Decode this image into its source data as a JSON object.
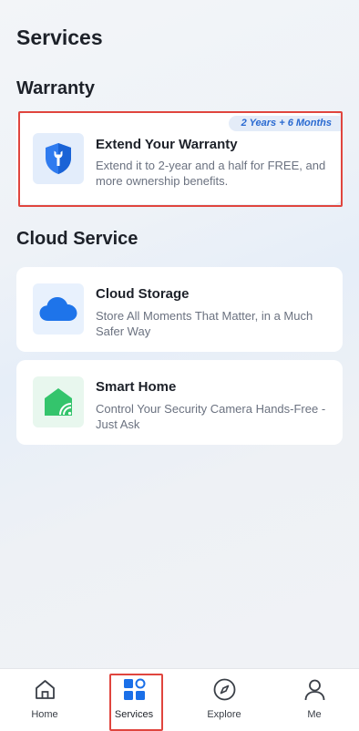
{
  "page": {
    "title": "Services"
  },
  "warranty": {
    "section_title": "Warranty",
    "card": {
      "badge": "2 Years + 6 Months",
      "title": "Extend Your Warranty",
      "description": "Extend it to 2-year and a half for FREE, and more ownership benefits.",
      "icon": "shield-wrench-icon"
    }
  },
  "cloud_service": {
    "section_title": "Cloud Service",
    "items": [
      {
        "title": "Cloud Storage",
        "description": "Store All Moments That Matter, in a Much Safer Way",
        "icon": "cloud-icon"
      },
      {
        "title": "Smart Home",
        "description": "Control Your Security Camera Hands-Free - Just Ask",
        "icon": "smart-home-icon"
      }
    ]
  },
  "tabbar": {
    "tabs": [
      {
        "label": "Home",
        "icon": "home-icon"
      },
      {
        "label": "Services",
        "icon": "services-icon",
        "active": true
      },
      {
        "label": "Explore",
        "icon": "compass-icon"
      },
      {
        "label": "Me",
        "icon": "person-icon"
      }
    ]
  },
  "colors": {
    "accent": "#1a6fe8",
    "highlight": "#e0453e",
    "badge_text": "#2a6ad1",
    "smart_home_green": "#34c46c"
  }
}
